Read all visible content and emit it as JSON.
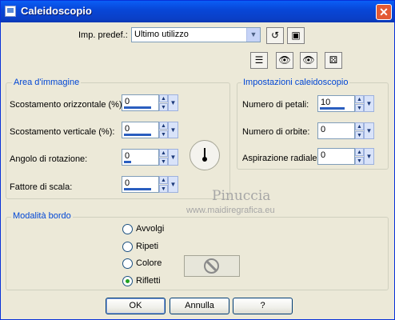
{
  "window": {
    "title": "Caleidoscopio",
    "close_glyph": "✕"
  },
  "preset": {
    "label": "Imp. predef.:",
    "value": "Ultimo utilizzo"
  },
  "image_area": {
    "legend": "Area d'immagine",
    "fields": [
      {
        "label": "Scostamento orizzontale (%):",
        "value": "0",
        "bar_fraction": 0.8
      },
      {
        "label": "Scostamento verticale (%):",
        "value": "0",
        "bar_fraction": 0.8
      },
      {
        "label": "Angolo di rotazione:",
        "value": "0",
        "bar_fraction": 0.2
      },
      {
        "label": "Fattore di scala:",
        "value": "0",
        "bar_fraction": 0.8
      }
    ]
  },
  "kaleidoscope": {
    "legend": "Impostazioni caleidoscopio",
    "fields": [
      {
        "label": "Numero di petali:",
        "value": "10",
        "bar_fraction": 0.7
      },
      {
        "label": "Numero di orbite:",
        "value": "0",
        "bar_fraction": 0.0
      },
      {
        "label": "Aspirazione radiale:",
        "value": "0",
        "bar_fraction": 0.0
      }
    ]
  },
  "border_mode": {
    "legend": "Modalità bordo",
    "options": [
      {
        "label": "Avvolgi",
        "checked": false
      },
      {
        "label": "Ripeti",
        "checked": false
      },
      {
        "label": "Colore",
        "checked": false
      },
      {
        "label": "Rifletti",
        "checked": true
      }
    ]
  },
  "watermark": {
    "line1": "Pinuccia",
    "line2": "www.maidiregrafica.eu"
  },
  "buttons": {
    "ok": "OK",
    "cancel": "Annulla",
    "help": "?"
  },
  "icons": {
    "app": "app-icon",
    "reset": "reset-icon",
    "save": "save-preset-icon",
    "dialog": "dialog-settings-icon",
    "proof1": "proof-icon",
    "proof2": "auto-proof-icon",
    "random": "randomize-icon",
    "no_color": "no-color-icon"
  },
  "colors": {
    "title_bar": "#0a5ef6",
    "group_legend": "#0046d5",
    "dialog_bg": "#ece9d8"
  }
}
